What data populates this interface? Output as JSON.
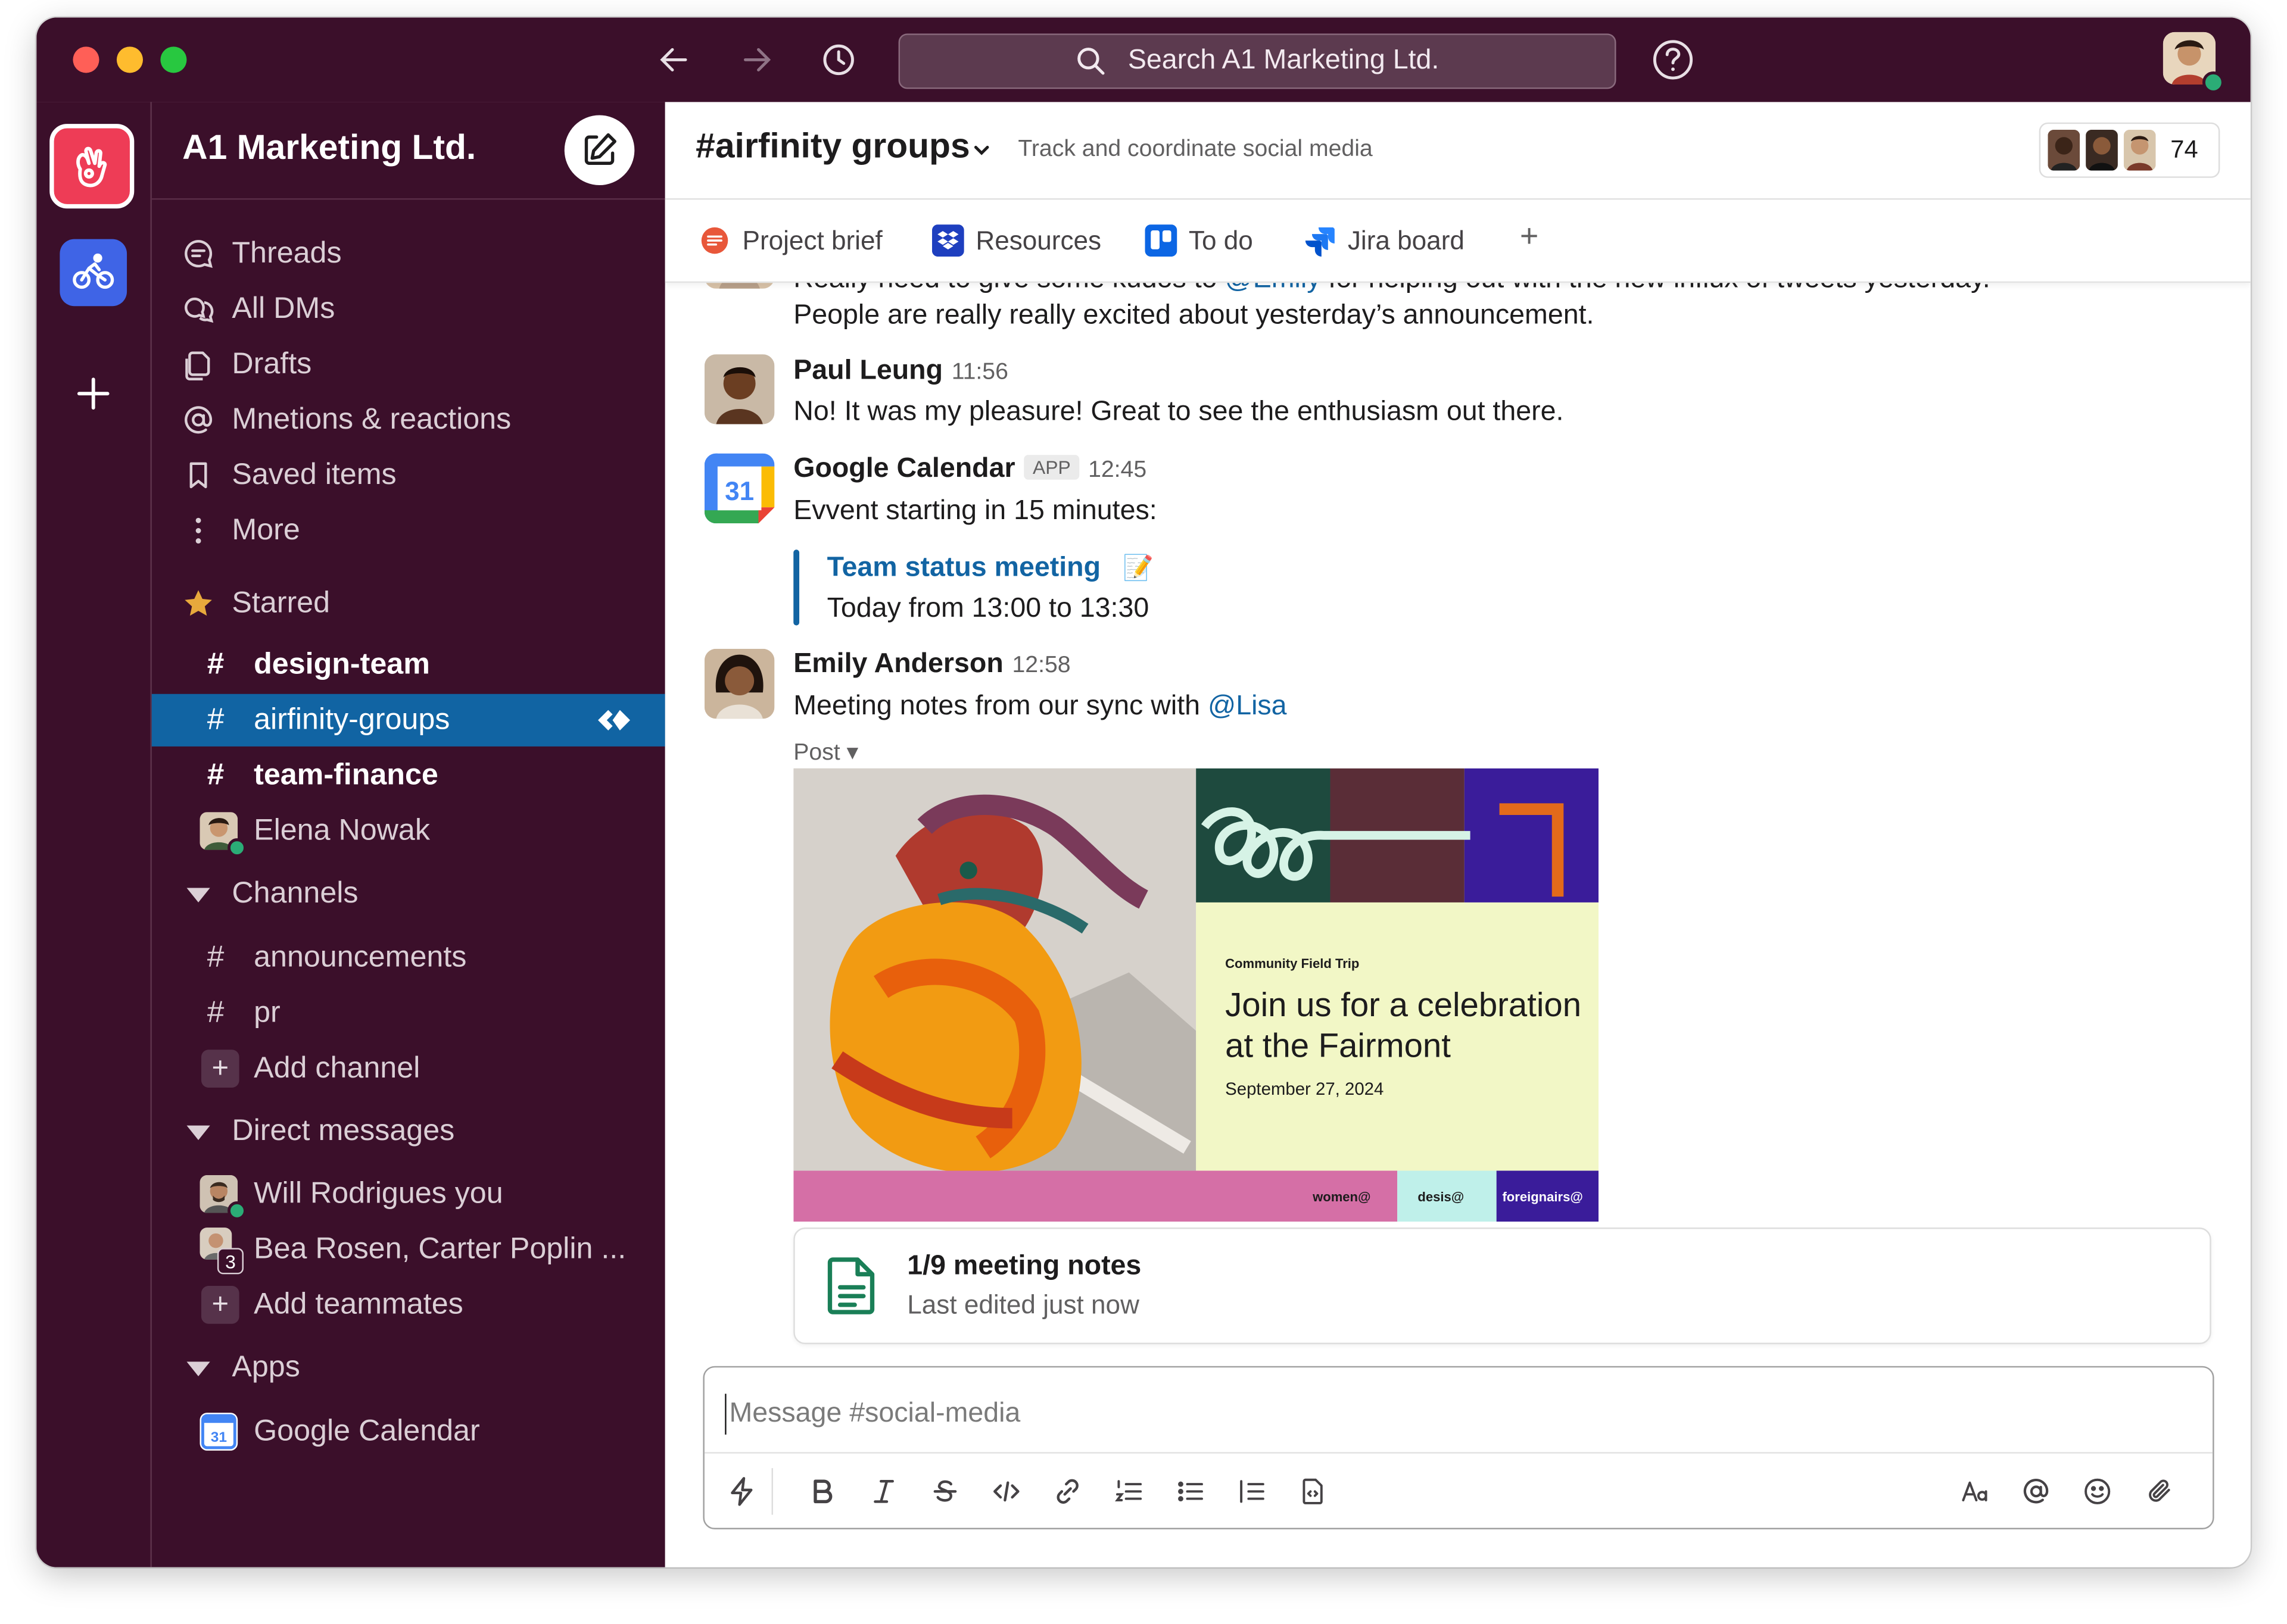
{
  "titlebar": {
    "search_placeholder": "Search A1 Marketing Ltd."
  },
  "workspace": {
    "name": "A1 Marketing Ltd."
  },
  "sidebar": {
    "nav": [
      {
        "label": "Threads",
        "icon": "threads-icon"
      },
      {
        "label": "All DMs",
        "icon": "dms-icon"
      },
      {
        "label": "Drafts",
        "icon": "drafts-icon"
      },
      {
        "label": "Mnetions & reactions",
        "icon": "at-icon"
      },
      {
        "label": "Saved items",
        "icon": "bookmark-icon"
      },
      {
        "label": "More",
        "icon": "more-icon"
      }
    ],
    "starred_label": "Starred",
    "starred": [
      {
        "label": "design-team"
      },
      {
        "label": "airfinity-groups"
      },
      {
        "label": "team-finance"
      }
    ],
    "starred_dm": "Elena Nowak",
    "channels_label": "Channels",
    "channels": [
      {
        "label": "announcements"
      },
      {
        "label": "pr"
      }
    ],
    "add_channel": "Add channel",
    "dm_label": "Direct messages",
    "dms": [
      {
        "label": "Will Rodrigues you"
      },
      {
        "label": "Bea Rosen, Carter Poplin ...",
        "count": "3"
      }
    ],
    "add_teammates": "Add teammates",
    "apps_label": "Apps",
    "apps": [
      {
        "label": "Google Calendar",
        "icon_text": "31"
      }
    ]
  },
  "channel": {
    "name": "#airfinity groups",
    "topic": "Track and coordinate social media",
    "member_count": "74",
    "tabs": [
      {
        "label": "Project brief"
      },
      {
        "label": "Resources"
      },
      {
        "label": "To do"
      },
      {
        "label": "Jira board"
      }
    ],
    "add_tab": "+"
  },
  "messages": {
    "partial_line1_a": "Really need to give some kudos to ",
    "partial_line1_mention": "@Emily",
    "partial_line1_b": " for helping out with the new influx of tweets yesterday.",
    "partial_line2": "People are really really excited about yesterday’s announcement.",
    "paul": {
      "author": "Paul Leung",
      "time": "11:56",
      "text": "No! It was my pleasure! Great to see the enthusiasm out there."
    },
    "gcal": {
      "author": "Google Calendar",
      "badge": "APP",
      "time": "12:45",
      "icon_text": "31",
      "text": "Evvent starting in 15 minutes:",
      "event_title": "Team status meeting",
      "event_emoji": "📝",
      "event_time": "Today from 13:00 to 13:30"
    },
    "emily": {
      "author": "Emily Anderson",
      "time": "12:58",
      "text_a": "Meeting notes from our sync with ",
      "mention": "@Lisa",
      "post_label": "Post ▾",
      "poster": {
        "kicker": "Community Field Trip",
        "headline_1": "Join us for a celebration",
        "headline_2": "at the Fairmont",
        "date": "September 27, 2024",
        "logo_1": "women@",
        "logo_2": "desis@",
        "logo_3": "foreignairs@"
      },
      "note_title": "1/9 meeting notes",
      "note_sub": "Last edited just now"
    }
  },
  "composer": {
    "placeholder": "Message #social-media"
  },
  "colors": {
    "aubergine": "#3b0f2a",
    "active_blue": "#1164a3",
    "link_blue": "#1264a3",
    "online_green": "#2bac76"
  }
}
